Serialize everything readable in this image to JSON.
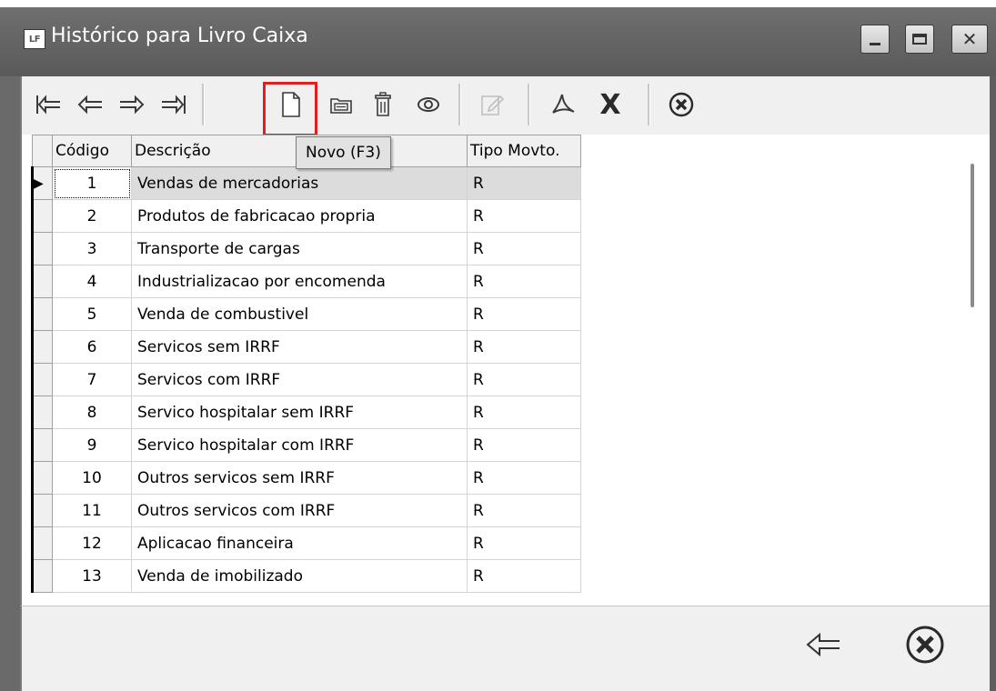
{
  "window": {
    "title": "Histórico para Livro Caixa",
    "app_icon_text": "LF"
  },
  "toolbar": {
    "buttons": [
      {
        "name": "first-record-button",
        "icon": "first-arrow-icon",
        "glyph": "⇤"
      },
      {
        "name": "previous-record-button",
        "icon": "left-arrow-icon",
        "glyph": "⇐"
      },
      {
        "name": "next-record-button",
        "icon": "right-arrow-icon",
        "glyph": "⇒"
      },
      {
        "name": "last-record-button",
        "icon": "last-arrow-icon",
        "glyph": "⇥"
      },
      {
        "name": "new-button",
        "icon": "new-document-icon"
      },
      {
        "name": "edit-button",
        "icon": "folder-edit-icon"
      },
      {
        "name": "delete-button",
        "icon": "trash-icon"
      },
      {
        "name": "view-button",
        "icon": "eye-icon"
      },
      {
        "name": "confirm-button",
        "icon": "pencil-icon",
        "disabled": true
      },
      {
        "name": "pdf-button",
        "icon": "pdf-icon"
      },
      {
        "name": "excel-button",
        "icon": "excel-x-icon"
      },
      {
        "name": "close-toolbar-button",
        "icon": "cancel-circle-icon"
      }
    ],
    "tooltip": "Novo (F3)"
  },
  "grid": {
    "columns": [
      "Código",
      "Descrição",
      "Tipo Movto."
    ],
    "rows": [
      {
        "codigo": "1",
        "descricao": "Vendas de mercadorias",
        "tipo": "R"
      },
      {
        "codigo": "2",
        "descricao": "Produtos de fabricacao propria",
        "tipo": "R"
      },
      {
        "codigo": "3",
        "descricao": "Transporte de cargas",
        "tipo": "R"
      },
      {
        "codigo": "4",
        "descricao": "Industrializacao por encomenda",
        "tipo": "R"
      },
      {
        "codigo": "5",
        "descricao": "Venda de combustivel",
        "tipo": "R"
      },
      {
        "codigo": "6",
        "descricao": "Servicos sem IRRF",
        "tipo": "R"
      },
      {
        "codigo": "7",
        "descricao": "Servicos com IRRF",
        "tipo": "R"
      },
      {
        "codigo": "8",
        "descricao": "Servico hospitalar sem IRRF",
        "tipo": "R"
      },
      {
        "codigo": "9",
        "descricao": "Servico hospitalar com IRRF",
        "tipo": "R"
      },
      {
        "codigo": "10",
        "descricao": "Outros servicos sem IRRF",
        "tipo": "R"
      },
      {
        "codigo": "11",
        "descricao": "Outros servicos com IRRF",
        "tipo": "R"
      },
      {
        "codigo": "12",
        "descricao": "Aplicacao financeira",
        "tipo": "R"
      },
      {
        "codigo": "13",
        "descricao": "Venda de imobilizado",
        "tipo": "R"
      }
    ],
    "selected_row_indicator": "▶"
  },
  "footer": {
    "back_icon": "left-arrow-icon",
    "close_icon": "cancel-circle-icon"
  },
  "colors": {
    "titlebar": "#5f5f5f",
    "highlight": "#e02020",
    "selected_row": "#dcdcdc"
  }
}
